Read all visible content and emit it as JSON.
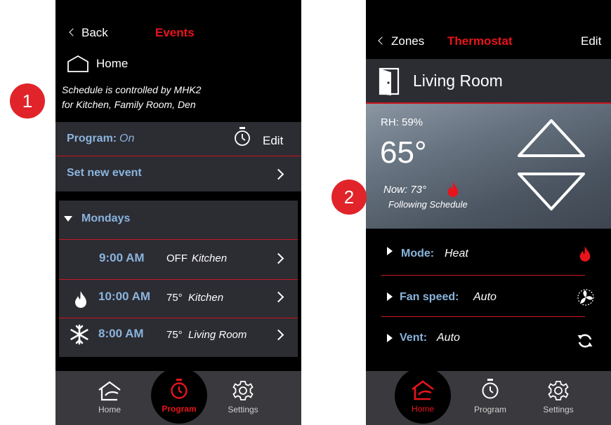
{
  "screen1": {
    "header": {
      "back_label": "Back",
      "title": "Events"
    },
    "location": {
      "label": "Home"
    },
    "schedule_note": {
      "line1": "Schedule is controlled  by MHK2",
      "line2": "for  Kitchen, Family Room, Den"
    },
    "program": {
      "label": "Program:",
      "value": "On",
      "edit_label": "Edit"
    },
    "set_event_label": "Set new event",
    "day_group": {
      "label": "Mondays"
    },
    "events": [
      {
        "time": "9:00 AM",
        "setting": "OFF",
        "room": "Kitchen",
        "icon": "none"
      },
      {
        "time": "10:00 AM",
        "setting": "75°",
        "room": "Kitchen",
        "icon": "flame-icon"
      },
      {
        "time": "8:00 AM",
        "setting": "75°",
        "room": "Living Room",
        "icon": "snowflake-icon"
      }
    ],
    "tabs": [
      {
        "label": "Home",
        "icon": "house-icon",
        "active": false
      },
      {
        "label": "Program",
        "icon": "stopwatch-icon",
        "active": true
      },
      {
        "label": "Settings",
        "icon": "gear-icon",
        "active": false
      }
    ]
  },
  "screen2": {
    "header": {
      "back_label": "Zones",
      "title": "Thermostat",
      "edit_label": "Edit"
    },
    "room": {
      "name": "Living Room",
      "icon": "door-icon"
    },
    "climate": {
      "rh": "RH: 59%",
      "setpoint": "65°",
      "now": "Now: 73°",
      "following": "Following  Schedule"
    },
    "settings": [
      {
        "label": "Mode:",
        "value": "Heat",
        "icon": "flame-icon"
      },
      {
        "label": "Fan speed:",
        "value": "Auto",
        "icon": "fan-icon"
      },
      {
        "label": "Vent:",
        "value": "Auto",
        "icon": "refresh-icon"
      }
    ],
    "tabs": [
      {
        "label": "Home",
        "icon": "house-icon",
        "active": true
      },
      {
        "label": "Program",
        "icon": "stopwatch-icon",
        "active": false
      },
      {
        "label": "Settings",
        "icon": "gear-icon",
        "active": false
      }
    ]
  },
  "callouts": {
    "one": "1",
    "two": "2"
  },
  "colors": {
    "accent": "#e8141b",
    "label_blue": "#8ab4dc",
    "panel": "#2c2c33",
    "tabbar": "#3a3a3e"
  }
}
